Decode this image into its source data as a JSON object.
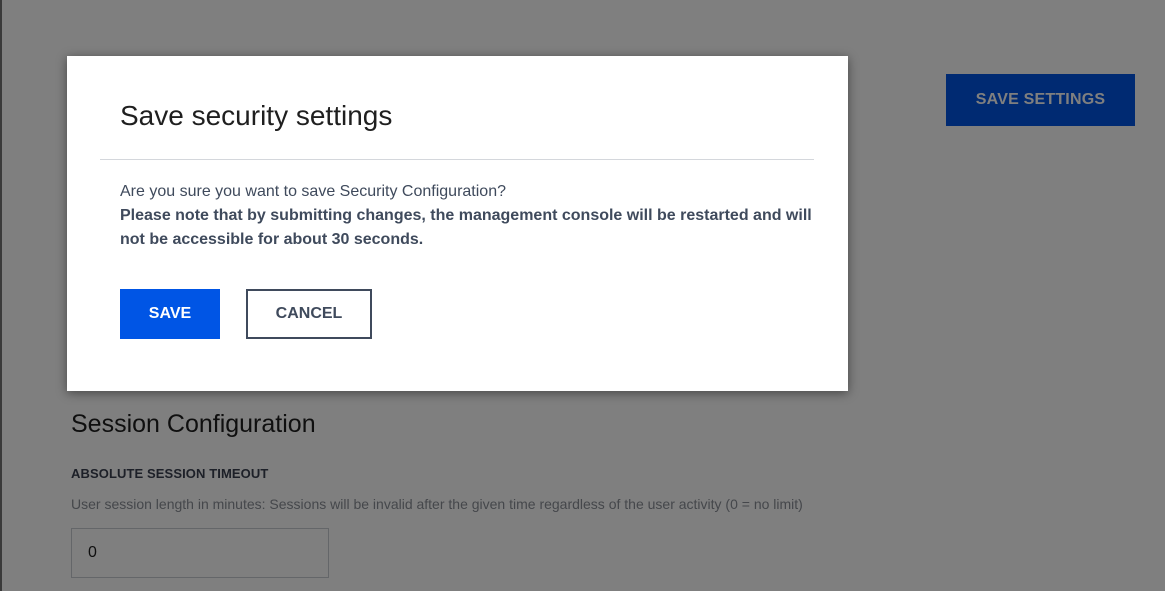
{
  "page": {
    "save_settings_label": "SAVE SETTINGS",
    "section_title": "Session Configuration",
    "absolute_timeout_label": "ABSOLUTE SESSION TIMEOUT",
    "absolute_timeout_help": "User session length in minutes: Sessions will be invalid after the given time regardless of the user activity (0 = no limit)",
    "absolute_timeout_value": "0"
  },
  "modal": {
    "title": "Save security settings",
    "message": "Are you sure you want to save Security Configuration?",
    "note": "Please note that by submitting changes, the management console will be restarted and will not be accessible for about 30 seconds.",
    "save_label": "SAVE",
    "cancel_label": "CANCEL"
  },
  "colors": {
    "primary": "#0055e5",
    "overlay": "rgba(0,0,0,0.5)",
    "text_dark": "#3f4a5c"
  }
}
